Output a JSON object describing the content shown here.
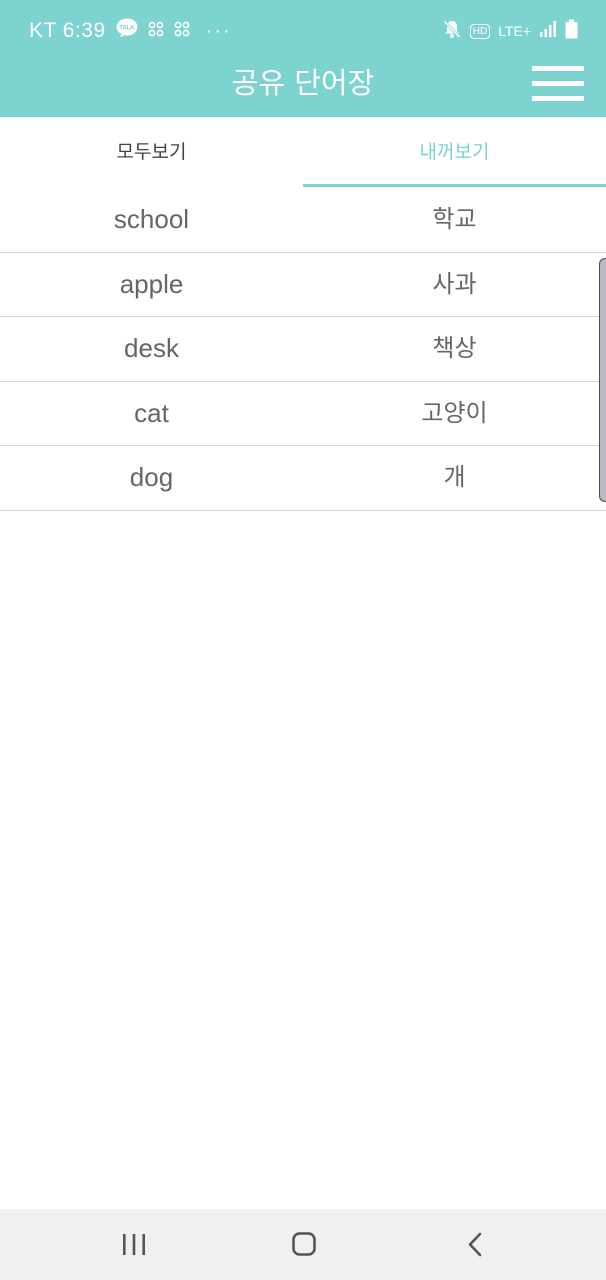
{
  "status_bar": {
    "carrier_time": "KT 6:39",
    "kakaotalk_badge": "TALK",
    "more_dots": "···",
    "hd_badge": "HD",
    "network": "LTE+"
  },
  "app_bar": {
    "title": "공유 단어장"
  },
  "tabs": [
    {
      "label": "모두보기",
      "selected": false
    },
    {
      "label": "내꺼보기",
      "selected": true
    }
  ],
  "words": [
    {
      "word": "school",
      "meaning": "학교"
    },
    {
      "word": "apple",
      "meaning": "사과"
    },
    {
      "word": "desk",
      "meaning": "책상"
    },
    {
      "word": "cat",
      "meaning": "고양이"
    },
    {
      "word": "dog",
      "meaning": "개"
    }
  ],
  "colors": {
    "accent": "#7cd3d0",
    "text": "#666666",
    "divider": "#d4d4d4"
  },
  "icons": {
    "status": [
      "kakaotalk-icon",
      "notification-icon",
      "notification-icon",
      "mute-icon",
      "signal-icon",
      "battery-icon"
    ],
    "app_bar": [
      "hamburger-menu-icon"
    ],
    "nav": [
      "recent-apps-icon",
      "home-icon",
      "back-icon"
    ]
  }
}
